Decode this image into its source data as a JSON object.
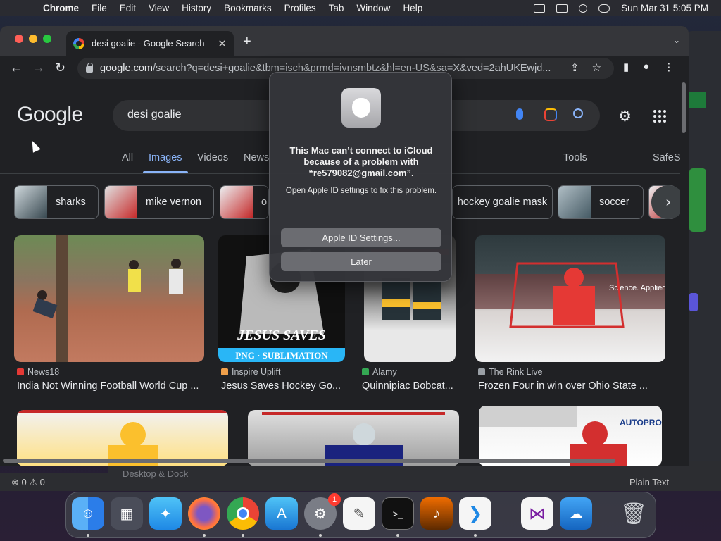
{
  "menubar": {
    "app_name": "Chrome",
    "items": [
      "File",
      "Edit",
      "View",
      "History",
      "Bookmarks",
      "Profiles",
      "Tab",
      "Window",
      "Help"
    ],
    "clock": "Sun Mar 31  5:05 PM"
  },
  "browser": {
    "tab_title": "desi goalie - Google Search",
    "url_host": "google.com",
    "url_path": "/search?q=desi+goalie&tbm=isch&prmd=ivnsmbtz&hl=en-US&sa=X&ved=2ahUKEwjd..."
  },
  "google": {
    "logo": "Google",
    "query": "desi goalie",
    "nav_tabs": [
      "All",
      "Images",
      "Videos",
      "News",
      "Tools",
      "SafeS"
    ],
    "active_tab": "Images",
    "chips": [
      "sharks",
      "mike vernon",
      "ol",
      "hockey goalie mask",
      "soccer"
    ],
    "results": [
      {
        "source": "News18",
        "caption": "India Not Winning Football World Cup ...",
        "color": "#e53935"
      },
      {
        "source": "Inspire Uplift",
        "caption": "Jesus Saves Hockey Go...",
        "color": "#f0a04b"
      },
      {
        "source": "Alamy",
        "caption": "Quinnipiac Bobcat...",
        "color": "#34a853"
      },
      {
        "source": "The Rink Live",
        "caption": "Frozen Four in win over Ohio State ...",
        "color": "#9aa0a6"
      }
    ],
    "tile_text": {
      "png": "PNG · SUBLIMATION",
      "jesus": "JESUS SAVES",
      "autopro": "AUTOPRO",
      "science": "Science. Applied to Life"
    }
  },
  "dialog": {
    "title": "This Mac can’t connect to iCloud because of a problem with “re579082@gmail.com”.",
    "body": "Open Apple ID settings to fix this problem.",
    "primary_button": "Apple ID Settings...",
    "secondary_button": "Later"
  },
  "background": {
    "desktop_dock_label": "Desktop & Dock",
    "plain_text": "Plain Text",
    "status_counts": "⊗ 0 ⚠ 0"
  },
  "dock": {
    "apps": [
      "Finder",
      "Launchpad",
      "Safari",
      "Firefox",
      "Chrome",
      "App Store",
      "System Settings",
      "TextEdit",
      "Terminal",
      "GarageBand",
      "VS Code",
      "Visual Studio",
      "Weather",
      "Trash"
    ],
    "settings_badge": "1"
  },
  "colors": {
    "accent": "#8ab4f8",
    "page_bg": "#202124"
  }
}
